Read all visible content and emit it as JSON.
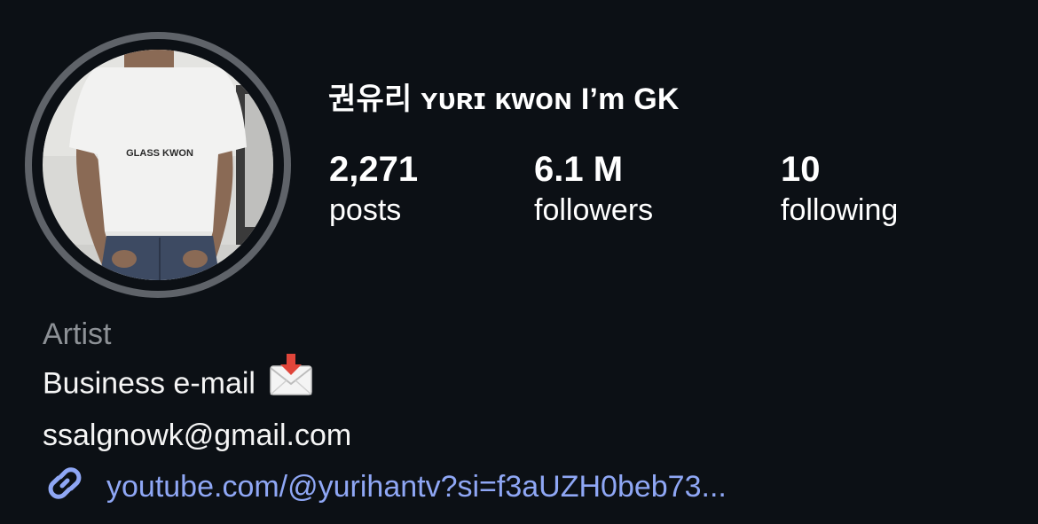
{
  "profile": {
    "display_name": "권유리 ʏᴜʀɪ ᴋᴡᴏɴ  I’m GK",
    "avatar_shirt_text": "GLASS KWON"
  },
  "stats": {
    "posts": {
      "count": "2,271",
      "label": "posts"
    },
    "followers": {
      "count": "6.1 M",
      "label": "followers"
    },
    "following": {
      "count": "10",
      "label": "following"
    }
  },
  "bio": {
    "category": "Artist",
    "line1": "Business e-mail",
    "line2": "ssalgnowk@gmail.com",
    "emoji_icon": "envelope-with-arrow-icon"
  },
  "link": {
    "text": "youtube.com/@yurihantv?si=f3aUZH0beb73...",
    "icon": "link-icon"
  },
  "colors": {
    "background": "#0c1015",
    "link": "#8fa7f5",
    "muted": "#8d9196",
    "ring": "#5f6369"
  }
}
